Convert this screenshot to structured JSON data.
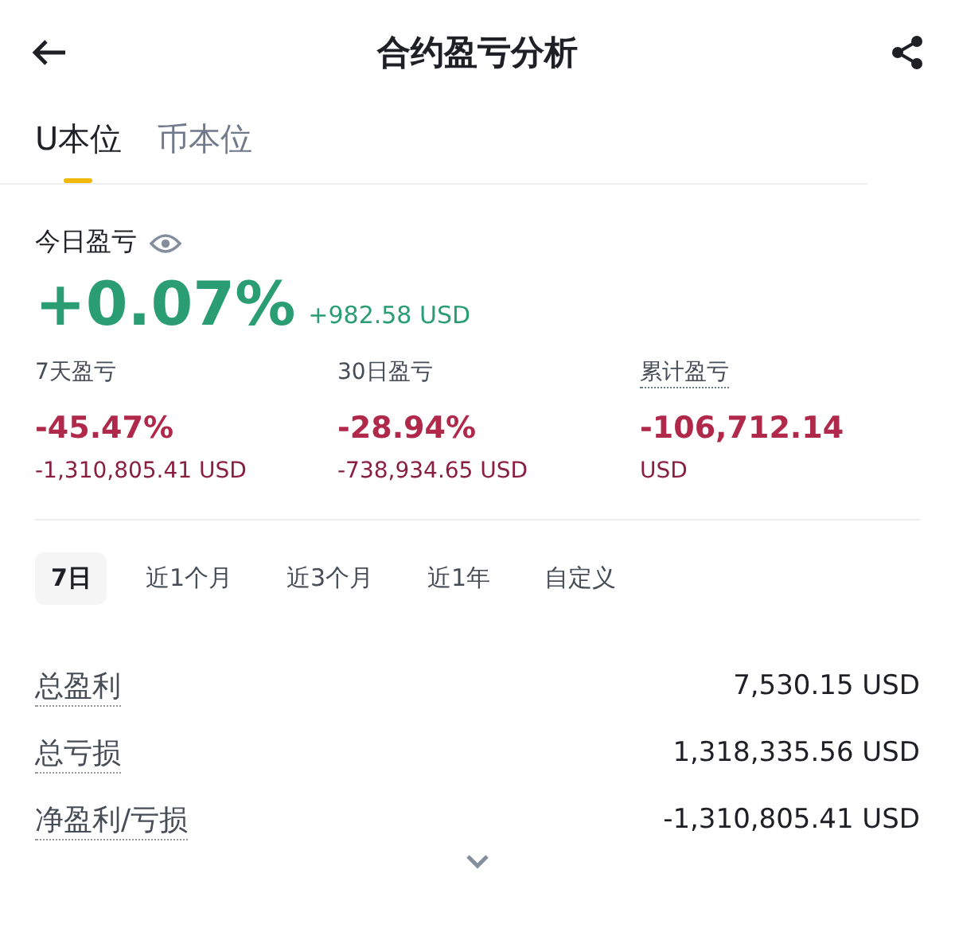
{
  "header": {
    "title": "合约盈亏分析"
  },
  "tabs": [
    {
      "label": "U本位",
      "selected": true
    },
    {
      "label": "币本位",
      "selected": false
    }
  ],
  "today": {
    "label": "今日盈亏",
    "percent": "+0.07%",
    "amount": "+982.58 USD"
  },
  "stats": [
    {
      "label": "7天盈亏",
      "hint": false,
      "value": "-45.47%",
      "sub": "-1,310,805.41 USD"
    },
    {
      "label": "30日盈亏",
      "hint": false,
      "value": "-28.94%",
      "sub": "-738,934.65 USD"
    },
    {
      "label": "累计盈亏",
      "hint": true,
      "value": "-106,712.14",
      "sub": "USD"
    }
  ],
  "periods": [
    {
      "label": "7日",
      "selected": true
    },
    {
      "label": "近1个月",
      "selected": false
    },
    {
      "label": "近3个月",
      "selected": false
    },
    {
      "label": "近1年",
      "selected": false
    },
    {
      "label": "自定义",
      "selected": false
    }
  ],
  "summary": [
    {
      "label": "总盈利",
      "value": "7,530.15 USD"
    },
    {
      "label": "总亏损",
      "value": "1,318,335.56 USD"
    },
    {
      "label": "净盈利/亏损",
      "value": "-1,310,805.41 USD"
    }
  ]
}
